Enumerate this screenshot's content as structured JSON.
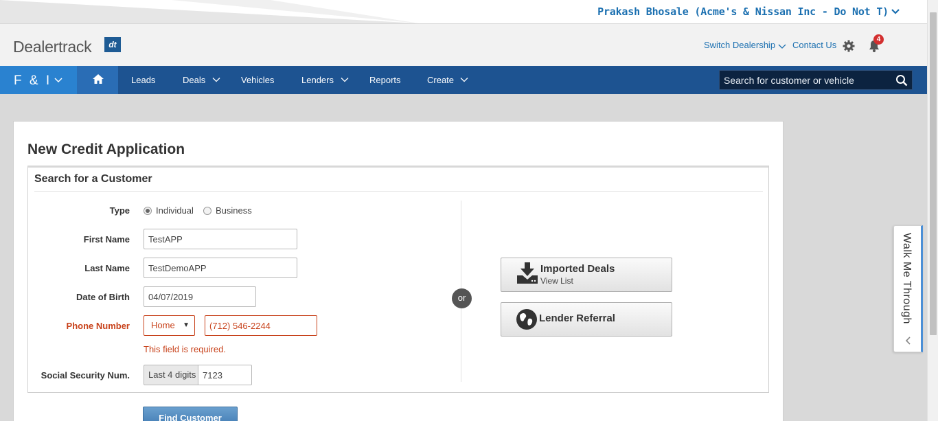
{
  "user": {
    "name": "Prakash Bhosale (Acme's & Nissan Inc - Do Not T)"
  },
  "brand": {
    "logo_text": "Dealertrack",
    "logo_mark": "dt"
  },
  "header": {
    "switch_dealership": "Switch Dealership",
    "contact_us": "Contact Us",
    "notification_count": "4"
  },
  "nav": {
    "module": "F & I",
    "items": [
      "Leads",
      "Deals",
      "Vehicles",
      "Lenders",
      "Reports",
      "Create"
    ],
    "search_placeholder": "Search for customer or vehicle"
  },
  "page": {
    "title": "New Credit Application",
    "section_title": "Search for a Customer",
    "form": {
      "type_label": "Type",
      "type_options": [
        "Individual",
        "Business"
      ],
      "type_selected": "Individual",
      "first_name_label": "First Name",
      "first_name_value": "TestAPP",
      "last_name_label": "Last Name",
      "last_name_value": "TestDemoAPP",
      "dob_label": "Date of Birth",
      "dob_value": "04/07/2019",
      "phone_label": "Phone Number",
      "phone_type": "Home",
      "phone_value": "(712) 546-2244",
      "phone_error": "This field is required.",
      "ssn_label": "Social Security Num.",
      "ssn_addon": "Last 4 digits",
      "ssn_value": "7123"
    },
    "or_label": "or",
    "imported_deals": {
      "title": "Imported Deals",
      "subtitle": "View List"
    },
    "lender_referral": {
      "title": "Lender Referral"
    },
    "find_button": "Find Customer"
  },
  "walkme": {
    "label": "Walk Me Through"
  },
  "colors": {
    "nav_bg": "#1d5391",
    "accent": "#2a82d0",
    "error": "#c8431c",
    "link": "#1a6fb0"
  }
}
